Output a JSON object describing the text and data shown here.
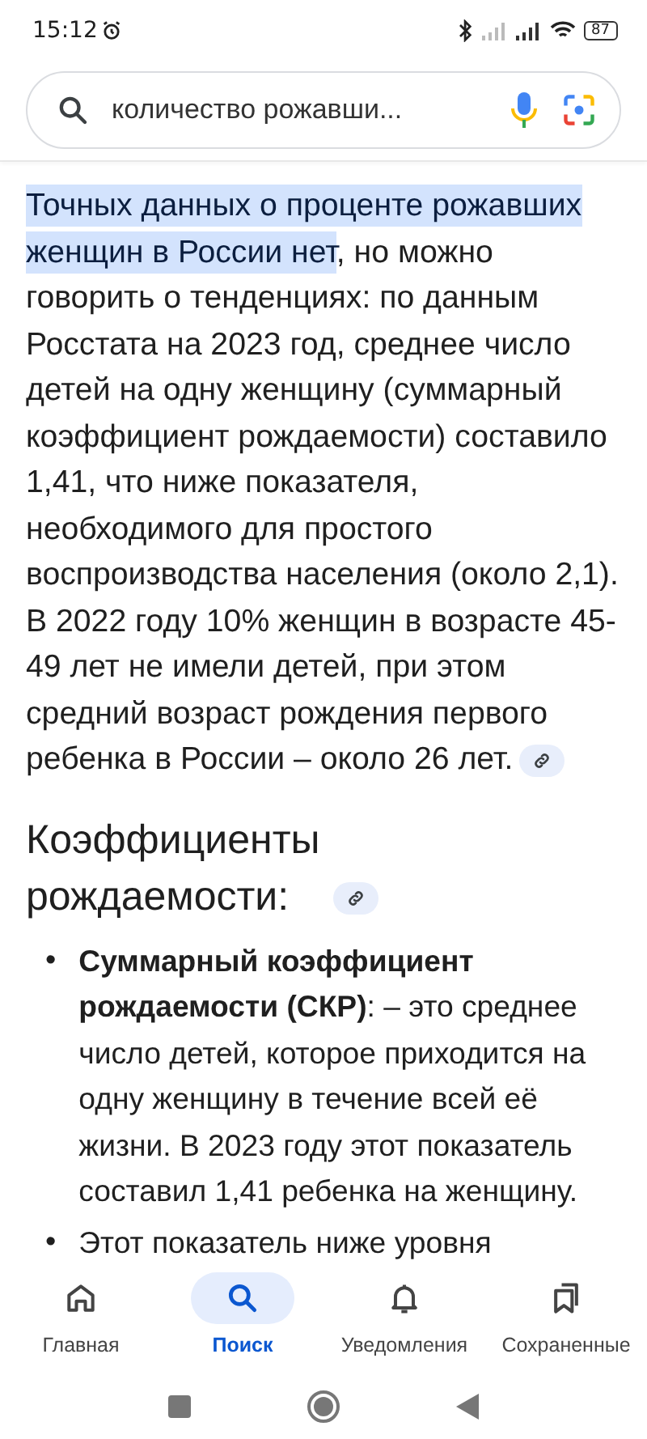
{
  "status_bar": {
    "time": "15:12",
    "battery": "87"
  },
  "search": {
    "value": "количество рожавши..."
  },
  "answer": {
    "highlighted": "Точных данных о проценте рожавших женщин в России нет",
    "text": ", но можно говорить о тенденциях: по данным Росстата на 2023 год, среднее число детей на одну женщину (суммарный коэффициент рождаемости) составило 1,41, что ниже показателя, необходимого для простого воспроизводства населения (около 2,1). В 2022 году 10% женщин в возрасте 45-49 лет не имели детей, при этом средний возраст рождения первого ребенка в России – около 26 лет."
  },
  "section": {
    "heading": "Коэффициенты рождаемости:"
  },
  "bullets": [
    {
      "marker": "•",
      "text": "**Суммарный коэффициент рождаемости (СКР)**: – это среднее число детей, которое приходится на одну женщину в течение всей её жизни. В 2023 году этот показатель составил 1,41 ребенка на женщину."
    },
    {
      "marker": "•",
      "text": "Этот показатель ниже уровня"
    }
  ],
  "nav": [
    {
      "label": "Главная",
      "selected": false
    },
    {
      "label": "Поиск",
      "selected": true
    },
    {
      "label": "Уведомления",
      "selected": false
    },
    {
      "label": "Сохраненные",
      "selected": false
    }
  ]
}
